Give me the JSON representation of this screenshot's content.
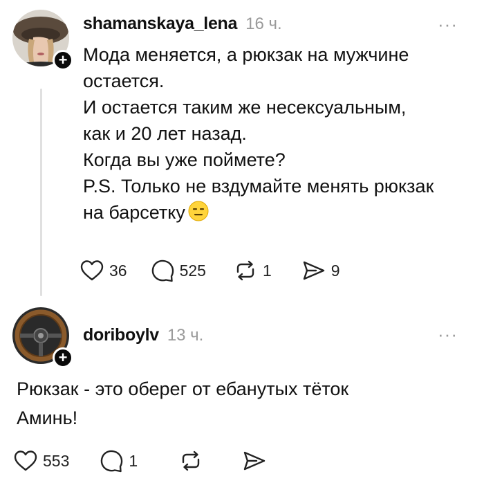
{
  "posts": [
    {
      "username": "shamanskaya_lena",
      "time": "16 ч.",
      "more": "···",
      "lines": [
        "Мода меняется, а рюкзак на мужчине",
        "остается.",
        "И остается таким же несексуальным,",
        "как и 20 лет назад.",
        "Когда вы уже поймете?",
        "P.S. Только не вздумайте менять рюкзак",
        "на барсетку"
      ],
      "emoji": "expressionless-face",
      "likes": "36",
      "comments": "525",
      "reposts": "1",
      "shares": "9"
    },
    {
      "username": "doriboylv",
      "time": "13 ч.",
      "more": "···",
      "lines": [
        "Рюкзак - это оберег от ебанутых тёток",
        "Аминь!"
      ],
      "likes": "553",
      "comments": "1"
    }
  ],
  "follow_badge": "+"
}
